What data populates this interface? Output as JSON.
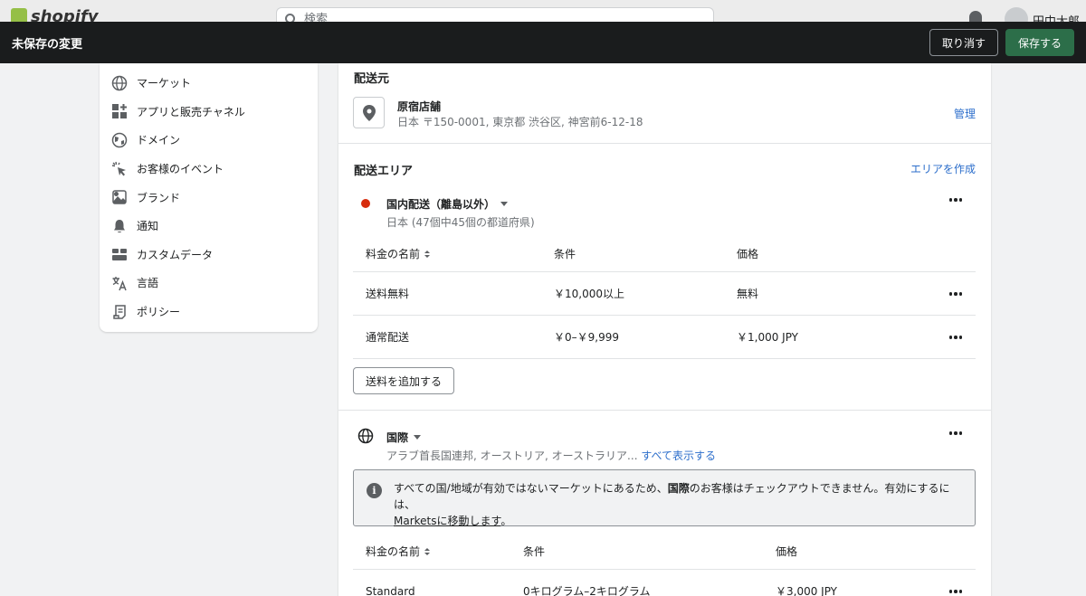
{
  "topbar": {
    "logo": "shopify",
    "search_placeholder": "検索",
    "user_name": "田中太郎"
  },
  "save_bar": {
    "title": "未保存の変更",
    "discard_label": "取り消す",
    "save_label": "保存する",
    "save_color": "#2c6e49"
  },
  "sidebar": {
    "items": [
      {
        "label": "マーケット",
        "icon": "globe-icon"
      },
      {
        "label": "アプリと販売チャネル",
        "icon": "apps-icon"
      },
      {
        "label": "ドメイン",
        "icon": "domain-globe-icon"
      },
      {
        "label": "お客様のイベント",
        "icon": "cursor-click-icon"
      },
      {
        "label": "ブランド",
        "icon": "brand-image-icon"
      },
      {
        "label": "通知",
        "icon": "bell-icon"
      },
      {
        "label": "カスタムデータ",
        "icon": "custom-data-icon"
      },
      {
        "label": "言語",
        "icon": "translate-icon"
      },
      {
        "label": "ポリシー",
        "icon": "policy-scroll-icon"
      }
    ]
  },
  "origin": {
    "heading": "配送元",
    "location_name": "原宿店舗",
    "address": "日本 〒150-0001, 東京都 渋谷区, 神宮前6-12-18",
    "manage_label": "管理"
  },
  "zones": {
    "heading": "配送エリア",
    "create_label": "エリアを作成",
    "domestic": {
      "title": "国内配送（離島以外）",
      "subtitle": "日本 (47個中45個の都道府県)",
      "status_color": "#d72c0d",
      "columns": [
        "料金の名前",
        "条件",
        "価格"
      ],
      "rows": [
        {
          "name": "送料無料",
          "condition": "￥10,000以上",
          "price": "無料"
        },
        {
          "name": "通常配送",
          "condition": "￥0–￥9,999",
          "price": "￥1,000 JPY"
        }
      ],
      "add_rate_label": "送料を追加する"
    },
    "international": {
      "title": "国際",
      "subtitle": "アラブ首長国連邦, オーストリア, オーストラリア...",
      "show_all_label": "すべて表示する",
      "banner_text_1": "すべての国/地域が有効ではないマーケットにあるため、",
      "banner_bold": "国際",
      "banner_text_2": "のお客様はチェックアウトできません。有効にするには、",
      "banner_link": "Marketsに移動します",
      "banner_end": "。",
      "columns": [
        "料金の名前",
        "条件",
        "価格"
      ],
      "rows": [
        {
          "name": "Standard",
          "condition": "0キログラム–2キログラム",
          "price": "￥3,000 JPY"
        }
      ]
    }
  }
}
